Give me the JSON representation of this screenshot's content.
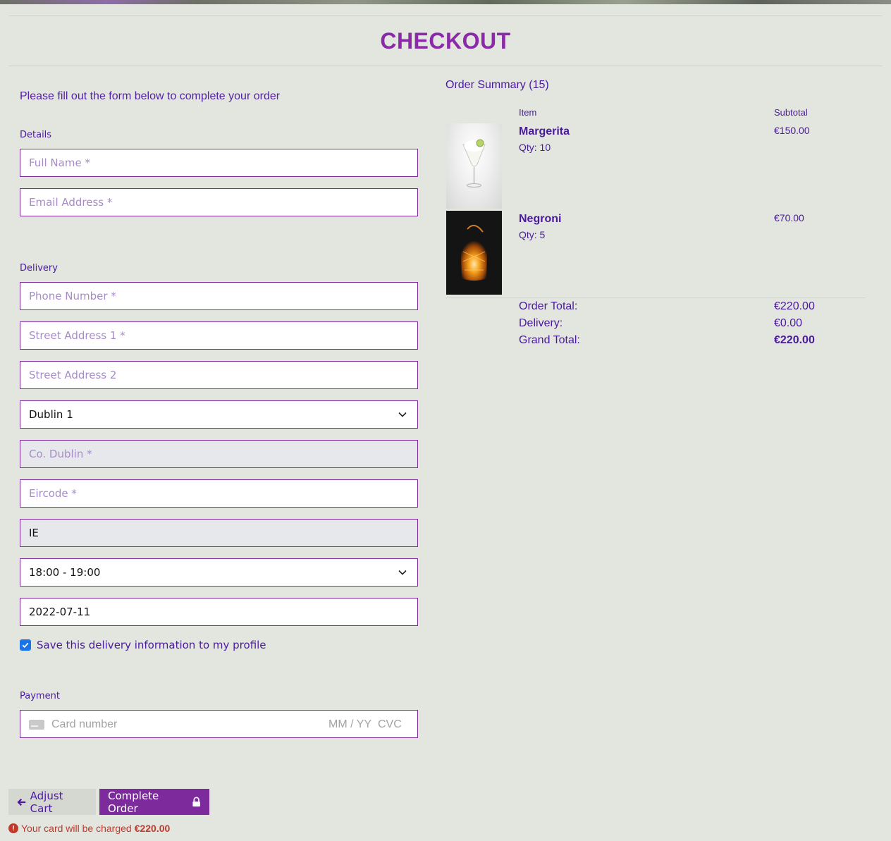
{
  "page": {
    "title": "CHECKOUT",
    "intro": "Please fill out the form below to complete your order"
  },
  "details": {
    "legend": "Details",
    "full_name_placeholder": "Full Name *",
    "email_placeholder": "Email Address *"
  },
  "delivery": {
    "legend": "Delivery",
    "phone_placeholder": "Phone Number *",
    "street1_placeholder": "Street Address 1 *",
    "street2_placeholder": "Street Address 2",
    "area_selected": "Dublin 1",
    "county_placeholder": "Co. Dublin *",
    "eircode_placeholder": "Eircode *",
    "country_value": "IE",
    "time_selected": "18:00 - 19:00",
    "date_value": "2022-07-11",
    "save_info_label": "Save this delivery information to my profile",
    "save_info_checked": true
  },
  "payment": {
    "legend": "Payment",
    "card_number_placeholder": "Card number",
    "expiry_placeholder": "MM / YY",
    "cvc_placeholder": "CVC"
  },
  "actions": {
    "adjust_cart_label": "Adjust Cart",
    "complete_order_label": "Complete Order",
    "charge_text": "Your card will be charged",
    "charge_amount": "€220.00"
  },
  "summary": {
    "title": "Order Summary (15)",
    "col_item": "Item",
    "col_subtotal": "Subtotal",
    "items": [
      {
        "name": "Margerita",
        "qty": "Qty: 10",
        "subtotal": "€150.00"
      },
      {
        "name": "Negroni",
        "qty": "Qty: 5",
        "subtotal": "€70.00"
      }
    ],
    "order_total_label": "Order Total:",
    "order_total": "€220.00",
    "delivery_label": "Delivery:",
    "delivery": "€0.00",
    "grand_total_label": "Grand Total:",
    "grand_total": "€220.00"
  },
  "colors": {
    "accent": "#7d2a9c",
    "text": "#4a1a9e",
    "background": "#e3e5df",
    "error": "#c0392b"
  }
}
